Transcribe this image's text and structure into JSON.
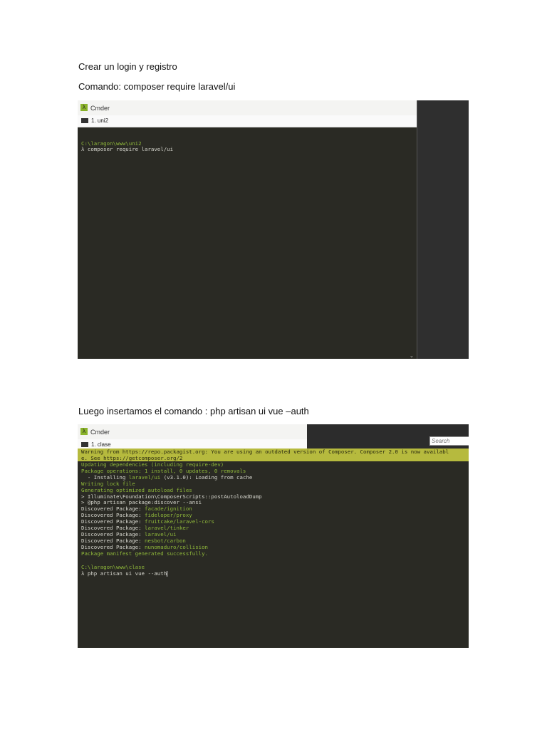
{
  "doc": {
    "heading1": "Crear un login y registro",
    "command1": "Comando: composer require laravel/ui",
    "heading2": "Luego insertamos el comando : php artisan ui vue –auth"
  },
  "shot1": {
    "window_title": "Cmder",
    "tab": "1. uni2",
    "lines": [
      "C:\\laragon\\www\\uni2",
      "λ composer require laravel/ui"
    ]
  },
  "shot2": {
    "window_title": "Cmder",
    "tab": "1. clase",
    "search_placeholder": "Search",
    "warning": [
      "Warning from https://repo.packagist.org: You are using an outdated version of Composer. Composer 2.0 is now availabl",
      "e. See https://getcomposer.org/2"
    ],
    "lines": [
      {
        "t": "Updating dependencies (including require-dev)",
        "c": "g"
      },
      {
        "t": "Package operations: 1 install, 0 updates, 0 removals",
        "c": "g"
      },
      {
        "t": "  - Installing ",
        "c": "",
        "p": "laravel/ui",
        "s": " (v3.1.0): Loading from cache"
      },
      {
        "t": "Writing lock file",
        "c": "g"
      },
      {
        "t": "Generating optimized autoload files",
        "c": "g"
      },
      {
        "t": "> Illuminate\\Foundation\\ComposerScripts::postAutoloadDump",
        "c": ""
      },
      {
        "t": "> @php artisan package:discover --ansi",
        "c": ""
      },
      {
        "t": "Discovered Package: ",
        "c": "",
        "p": "facade/ignition"
      },
      {
        "t": "Discovered Package: ",
        "c": "",
        "p": "fideloper/proxy"
      },
      {
        "t": "Discovered Package: ",
        "c": "",
        "p": "fruitcake/laravel-cors"
      },
      {
        "t": "Discovered Package: ",
        "c": "",
        "p": "laravel/tinker"
      },
      {
        "t": "Discovered Package: ",
        "c": "",
        "p": "laravel/ui"
      },
      {
        "t": "Discovered Package: ",
        "c": "",
        "p": "nesbot/carbon"
      },
      {
        "t": "Discovered Package: ",
        "c": "",
        "p": "nunomaduro/collision"
      },
      {
        "t": "Package manifest generated successfully.",
        "c": "g"
      }
    ],
    "prompt_path": "C:\\laragon\\www\\clase",
    "prompt_cmd": "λ php artisan ui vue --auth"
  }
}
